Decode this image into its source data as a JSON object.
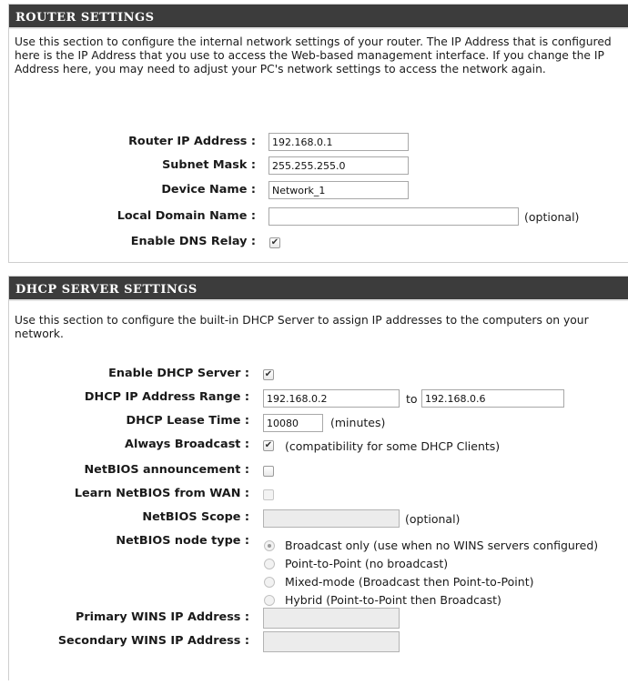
{
  "router": {
    "header": "ROUTER SETTINGS",
    "description": "Use this section to configure the internal network settings of your router. The IP Address that is configured here is the IP Address that you use to access the Web-based management interface. If you change the IP Address here, you may need to adjust your PC's network settings to access the network again.",
    "ip_label": "Router IP Address :",
    "ip_value": "192.168.0.1",
    "subnet_label": "Subnet Mask :",
    "subnet_value": "255.255.255.0",
    "device_label": "Device Name :",
    "device_value": "Network_1",
    "domain_label": "Local Domain Name :",
    "domain_value": "",
    "domain_hint": "(optional)",
    "dns_relay_label": "Enable DNS Relay :",
    "dns_relay_checked": true
  },
  "dhcp": {
    "header": "DHCP SERVER SETTINGS",
    "description": "Use this section to configure the built-in DHCP Server to assign IP addresses to the computers on your network.",
    "enable_label": "Enable DHCP Server :",
    "enable_checked": true,
    "range_label": "DHCP IP Address Range :",
    "range_start": "192.168.0.2",
    "range_to": "to",
    "range_end": "192.168.0.6",
    "lease_label": "DHCP Lease Time :",
    "lease_value": "10080",
    "lease_unit": "(minutes)",
    "broadcast_label": "Always Broadcast :",
    "broadcast_checked": true,
    "broadcast_hint": "(compatibility for some DHCP Clients)",
    "netbios_announce_label": "NetBIOS announcement :",
    "netbios_announce_checked": false,
    "netbios_wan_label": "Learn NetBIOS from WAN :",
    "netbios_wan_checked": false,
    "netbios_scope_label": "NetBIOS Scope :",
    "netbios_scope_value": "",
    "netbios_scope_hint": "(optional)",
    "node_type_label": "NetBIOS node type :",
    "node_options": [
      "Broadcast only (use when no WINS servers configured)",
      "Point-to-Point (no broadcast)",
      "Mixed-mode (Broadcast then Point-to-Point)",
      "Hybrid (Point-to-Point then Broadcast)"
    ],
    "node_selected": 0,
    "primary_wins_label": "Primary WINS IP Address :",
    "primary_wins_value": "",
    "secondary_wins_label": "Secondary WINS IP Address :",
    "secondary_wins_value": ""
  }
}
